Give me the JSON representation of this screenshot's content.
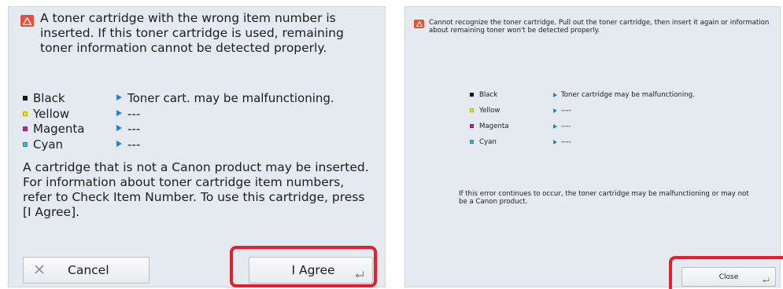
{
  "left_dialog": {
    "message": "A toner cartridge with the wrong item number is inserted. If this toner cartridge is used, remaining toner information cannot be detected properly.",
    "toners": [
      {
        "name": "Black",
        "status": "Toner cart. may be malfunctioning.",
        "color": "#1a1a1a"
      },
      {
        "name": "Yellow",
        "status": "---",
        "color": "#f3e700"
      },
      {
        "name": "Magenta",
        "status": "---",
        "color": "#c5268c"
      },
      {
        "name": "Cyan",
        "status": "---",
        "color": "#3fb8cf"
      }
    ],
    "info": "A cartridge that is not a Canon product may be inserted. For information about toner cartridge item numbers, refer to Check Item Number. To use this cartridge, press [I Agree].",
    "cancel_label": "Cancel",
    "agree_label": "I Agree"
  },
  "right_dialog": {
    "message": "Cannot recognize the toner cartridge. Pull out the toner cartridge, then insert it again or information about remaining toner won't be detected properly.",
    "toners": [
      {
        "name": "Black",
        "status": "Toner cartridge may be malfunctioning.",
        "color": "#1a1a1a"
      },
      {
        "name": "Yellow",
        "status": "----",
        "color": "#f3e700"
      },
      {
        "name": "Magenta",
        "status": "----",
        "color": "#c5268c"
      },
      {
        "name": "Cyan",
        "status": "----",
        "color": "#3fb8cf"
      }
    ],
    "info": "If this error continues to occur, the toner cartridge may be malfunctioning or may not be a Canon product.",
    "close_label": "Close"
  },
  "colors": {
    "panel_bg": "#e4eaf0",
    "highlight": "#e5202e",
    "warning_icon": "#e4503a",
    "arrow": "#2a80c6"
  },
  "icons": [
    "warning-icon",
    "close-x-icon",
    "enter-key-icon",
    "arrow-right-icon"
  ]
}
